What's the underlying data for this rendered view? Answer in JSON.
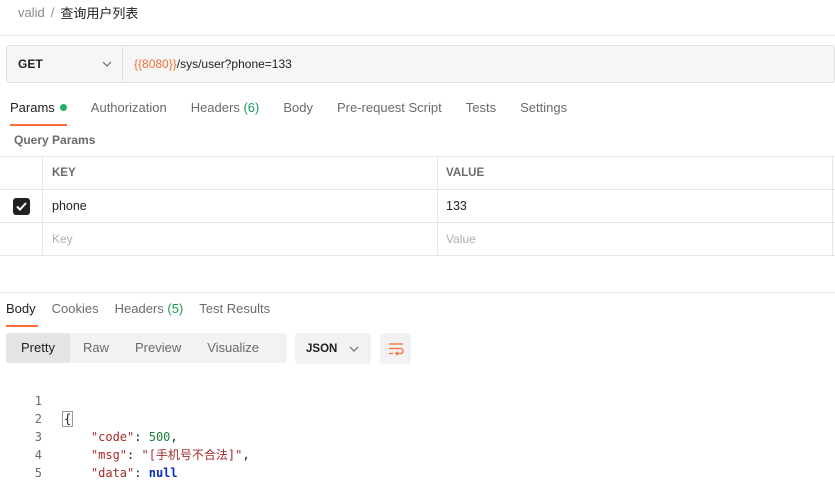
{
  "breadcrumb": {
    "parent": "valid",
    "separator": "/",
    "current": "查询用户列表"
  },
  "request": {
    "method": "GET",
    "url_variable": "{{8080}}",
    "url_path": "/sys/user?phone=133"
  },
  "request_tabs": [
    {
      "label": "Params",
      "active": true,
      "indicator": true
    },
    {
      "label": "Authorization"
    },
    {
      "label": "Headers",
      "count": "(6)"
    },
    {
      "label": "Body"
    },
    {
      "label": "Pre-request Script"
    },
    {
      "label": "Tests"
    },
    {
      "label": "Settings"
    }
  ],
  "query_params": {
    "title": "Query Params",
    "columns": [
      "KEY",
      "VALUE"
    ],
    "rows": [
      {
        "checked": true,
        "key": "phone",
        "value": "133"
      }
    ],
    "new_row": {
      "key_placeholder": "Key",
      "value_placeholder": "Value"
    }
  },
  "response_tabs": [
    {
      "label": "Body",
      "active": true
    },
    {
      "label": "Cookies"
    },
    {
      "label": "Headers",
      "count": "(5)"
    },
    {
      "label": "Test Results"
    }
  ],
  "view_modes": [
    {
      "label": "Pretty",
      "active": true
    },
    {
      "label": "Raw"
    },
    {
      "label": "Preview"
    },
    {
      "label": "Visualize"
    }
  ],
  "format": "JSON",
  "response_body": {
    "line_numbers": [
      "1",
      "2",
      "3",
      "4",
      "5"
    ],
    "open_brace": "{",
    "close_brace": "}",
    "fields": [
      {
        "key": "\"code\"",
        "value": "500",
        "type": "number",
        "trailing": ","
      },
      {
        "key": "\"msg\"",
        "value": "\"[手机号不合法]\"",
        "type": "string",
        "trailing": ","
      },
      {
        "key": "\"data\"",
        "value": "null",
        "type": "null",
        "trailing": ""
      }
    ]
  },
  "colors": {
    "accent": "#ff6c37",
    "url_variable": "#e8743b",
    "count_green": "#1c9a5b",
    "status_dot": "#1fb16a"
  },
  "icons": {
    "method_dropdown": "chevron-down-icon",
    "format_dropdown": "chevron-down-icon",
    "wrap_lines": "wrap-lines-icon",
    "checkbox": "checkmark-icon"
  }
}
